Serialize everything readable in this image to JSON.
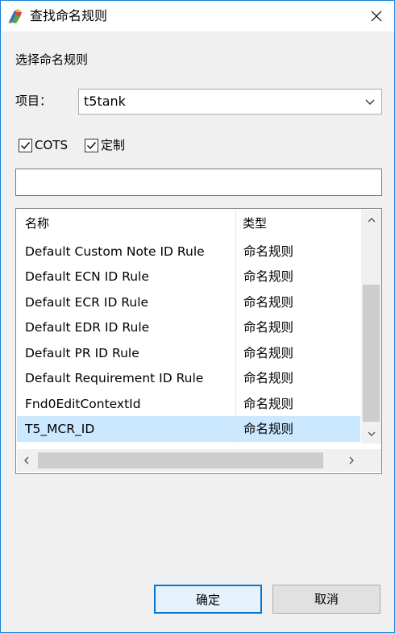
{
  "window": {
    "title": "查找命名规则",
    "icon": "app-icon",
    "close_icon": "close-icon"
  },
  "section_label": "选择命名规则",
  "project": {
    "label": "项目：",
    "value": "t5tank"
  },
  "filters": {
    "cots": {
      "label": "COTS",
      "checked": true
    },
    "custom": {
      "label": "定制",
      "checked": true
    }
  },
  "search": {
    "value": "",
    "placeholder": ""
  },
  "table": {
    "columns": [
      "名称",
      "类型"
    ],
    "rows": [
      {
        "name": "Default Custom Note ID Rule",
        "type": "命名规则",
        "selected": false
      },
      {
        "name": "Default ECN ID Rule",
        "type": "命名规则",
        "selected": false
      },
      {
        "name": "Default ECR ID Rule",
        "type": "命名规则",
        "selected": false
      },
      {
        "name": "Default EDR ID Rule",
        "type": "命名规则",
        "selected": false
      },
      {
        "name": "Default PR ID Rule",
        "type": "命名规则",
        "selected": false
      },
      {
        "name": "Default Requirement ID Rule",
        "type": "命名规则",
        "selected": false
      },
      {
        "name": "Fnd0EditContextId",
        "type": "命名规则",
        "selected": false
      },
      {
        "name": "T5_MCR_ID",
        "type": "命名规则",
        "selected": true
      }
    ]
  },
  "buttons": {
    "ok": "确定",
    "cancel": "取消"
  },
  "colors": {
    "accent": "#0078d7",
    "selection": "#cce8ff",
    "window_border": "#1883d7"
  }
}
